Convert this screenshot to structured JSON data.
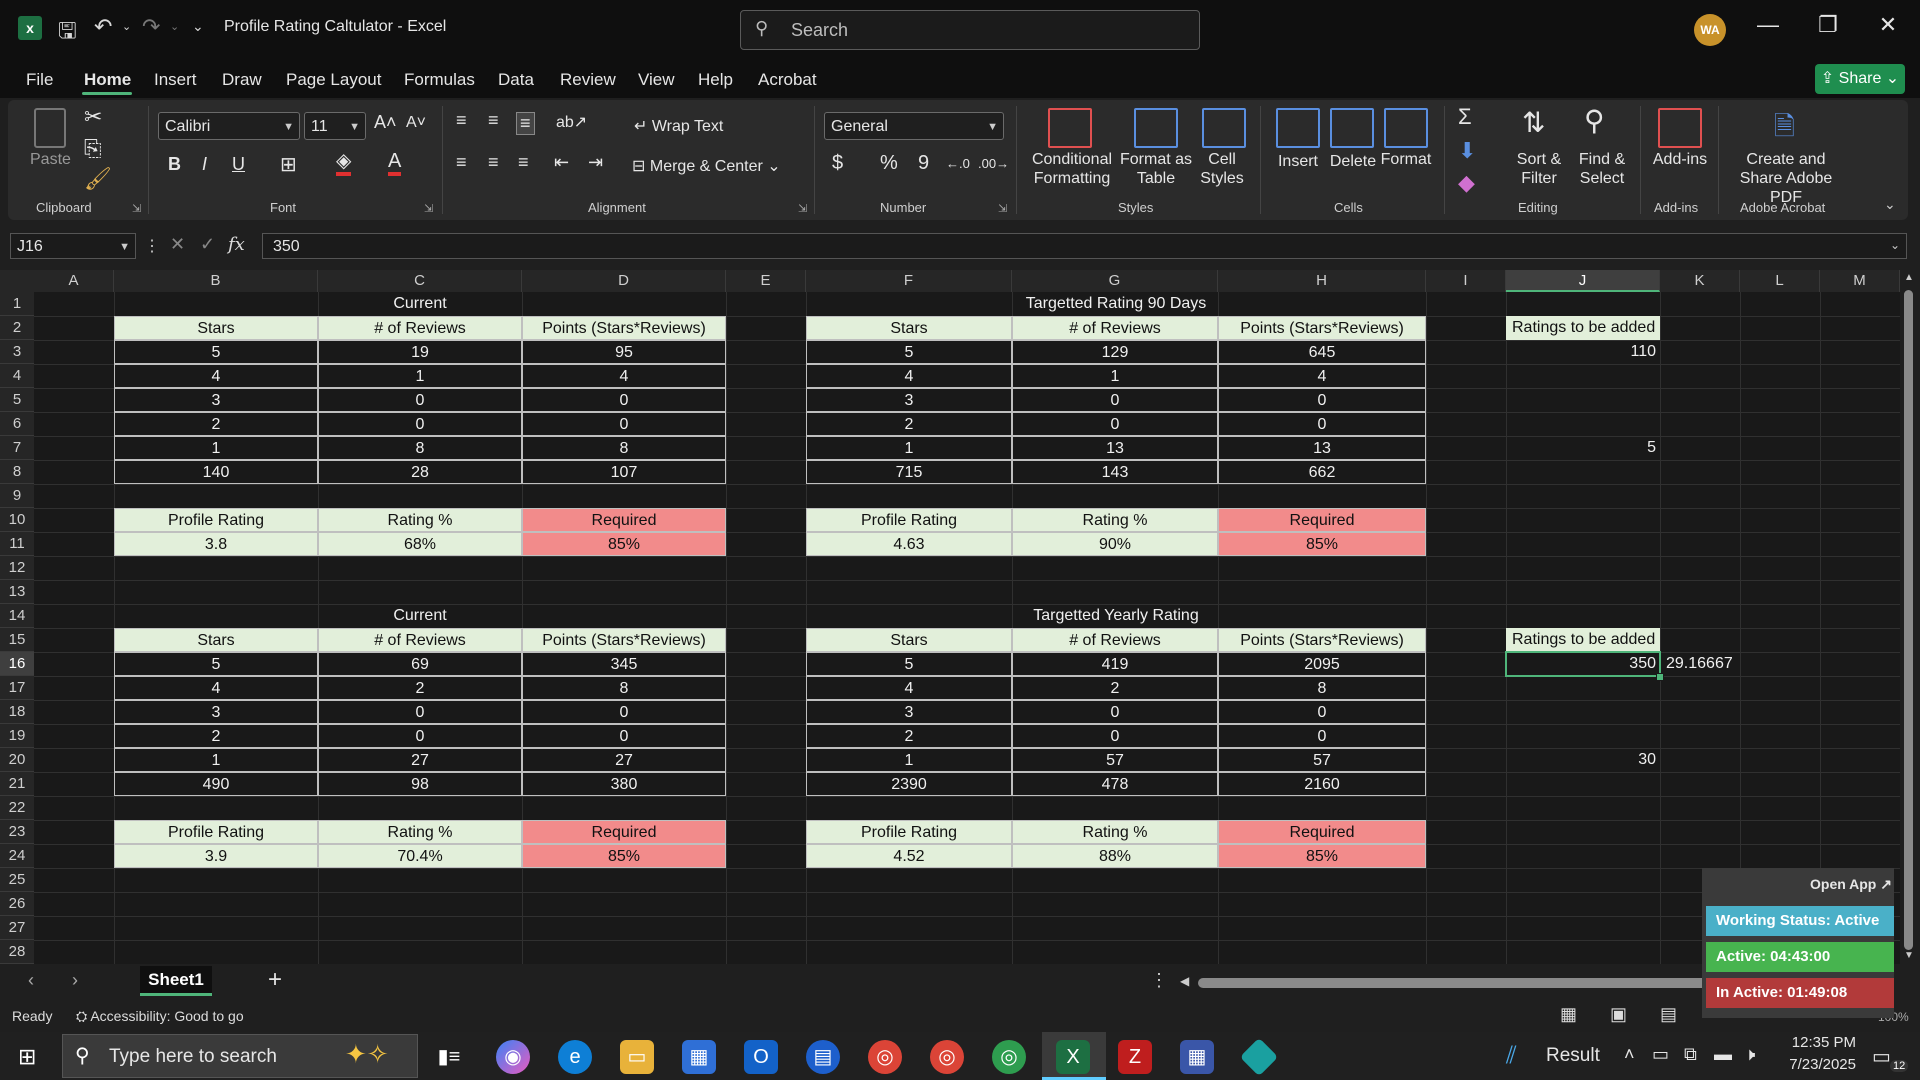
{
  "window": {
    "title": "Profile Rating Caltulator  -  Excel",
    "search_placeholder": "Search",
    "avatar_initials": "WA"
  },
  "menu": [
    "File",
    "Home",
    "Insert",
    "Draw",
    "Page Layout",
    "Formulas",
    "Data",
    "Review",
    "View",
    "Help",
    "Acrobat"
  ],
  "share_label": "Share",
  "ribbon": {
    "clipboard": {
      "paste": "Paste",
      "group": "Clipboard"
    },
    "font": {
      "name": "Calibri",
      "size": "11",
      "group": "Font",
      "bold": "B",
      "italic": "I",
      "underline": "U"
    },
    "alignment": {
      "wrap": "Wrap Text",
      "merge": "Merge & Center",
      "group": "Alignment"
    },
    "number": {
      "format": "General",
      "group": "Number",
      "currency": "$",
      "percent": "%",
      "comma": "9"
    },
    "styles": {
      "conditional": "Conditional Formatting",
      "format_table": "Format as Table",
      "cell_styles": "Cell Styles",
      "group": "Styles"
    },
    "cells": {
      "insert": "Insert",
      "delete": "Delete",
      "format": "Format",
      "group": "Cells"
    },
    "editing": {
      "sort": "Sort & Filter",
      "find": "Find & Select",
      "group": "Editing",
      "sigma": "Σ"
    },
    "addins": {
      "label": "Add-ins",
      "group": "Add-ins"
    },
    "acrobat": {
      "label": "Create and Share Adobe PDF",
      "group": "Adobe Acrobat"
    }
  },
  "formula_bar": {
    "name_box": "J16",
    "fx": "fx",
    "value": "350"
  },
  "columns": [
    "A",
    "B",
    "C",
    "D",
    "E",
    "F",
    "G",
    "H",
    "I",
    "J",
    "K",
    "L",
    "M"
  ],
  "rows": [
    "1",
    "2",
    "3",
    "4",
    "5",
    "6",
    "7",
    "8",
    "9",
    "10",
    "11",
    "12",
    "13",
    "14",
    "15",
    "16",
    "17",
    "18",
    "19",
    "20",
    "21",
    "22",
    "23",
    "24",
    "25",
    "26",
    "27",
    "28"
  ],
  "sheet": {
    "current_1": {
      "title": "Current",
      "headers": [
        "Stars",
        "# of Reviews",
        "Points (Stars*Reviews)"
      ],
      "rows": [
        [
          "5",
          "19",
          "95"
        ],
        [
          "4",
          "1",
          "4"
        ],
        [
          "3",
          "0",
          "0"
        ],
        [
          "2",
          "0",
          "0"
        ],
        [
          "1",
          "8",
          "8"
        ],
        [
          "140",
          "28",
          "107"
        ]
      ],
      "summary_headers": [
        "Profile Rating",
        "Rating %",
        "Required"
      ],
      "summary_values": [
        "3.8",
        "68%",
        "85%"
      ]
    },
    "target_90": {
      "title": "Targetted Rating 90 Days",
      "headers": [
        "Stars",
        "# of Reviews",
        "Points (Stars*Reviews)"
      ],
      "rows": [
        [
          "5",
          "129",
          "645"
        ],
        [
          "4",
          "1",
          "4"
        ],
        [
          "3",
          "0",
          "0"
        ],
        [
          "2",
          "0",
          "0"
        ],
        [
          "1",
          "13",
          "13"
        ],
        [
          "715",
          "143",
          "662"
        ]
      ],
      "summary_headers": [
        "Profile Rating",
        "Rating %",
        "Required"
      ],
      "summary_values": [
        "4.63",
        "90%",
        "85%"
      ]
    },
    "current_2": {
      "title": "Current",
      "headers": [
        "Stars",
        "# of Reviews",
        "Points (Stars*Reviews)"
      ],
      "rows": [
        [
          "5",
          "69",
          "345"
        ],
        [
          "4",
          "2",
          "8"
        ],
        [
          "3",
          "0",
          "0"
        ],
        [
          "2",
          "0",
          "0"
        ],
        [
          "1",
          "27",
          "27"
        ],
        [
          "490",
          "98",
          "380"
        ]
      ],
      "summary_headers": [
        "Profile Rating",
        "Rating %",
        "Required"
      ],
      "summary_values": [
        "3.9",
        "70.4%",
        "85%"
      ]
    },
    "target_yearly": {
      "title": "Targetted Yearly Rating",
      "headers": [
        "Stars",
        "# of Reviews",
        "Points (Stars*Reviews)"
      ],
      "rows": [
        [
          "5",
          "419",
          "2095"
        ],
        [
          "4",
          "2",
          "8"
        ],
        [
          "3",
          "0",
          "0"
        ],
        [
          "2",
          "0",
          "0"
        ],
        [
          "1",
          "57",
          "57"
        ],
        [
          "2390",
          "478",
          "2160"
        ]
      ],
      "summary_headers": [
        "Profile Rating",
        "Rating %",
        "Required"
      ],
      "summary_values": [
        "4.52",
        "88%",
        "85%"
      ]
    },
    "ratings_1": {
      "label": "Ratings to be added",
      "value_a": "110",
      "value_b": "5"
    },
    "ratings_2": {
      "label": "Ratings to be added",
      "value_a": "350",
      "value_k": "29.16667",
      "value_b": "30"
    }
  },
  "sheet_tab": "Sheet1",
  "status": {
    "ready": "Ready",
    "accessibility": "Accessibility: Good to go",
    "zoom": "100%"
  },
  "widget": {
    "open_app": "Open App ↗",
    "working": "Working Status: Active",
    "active": "Active: 04:43:00",
    "inactive": "In Active: 01:49:08"
  },
  "colors": {
    "green_fill": "#e2efda",
    "red_fill": "#f28b8b",
    "accent": "#4fb57a"
  },
  "taskbar": {
    "search_placeholder": "Type here to search",
    "weather": "Result",
    "time": "12:35 PM",
    "date": "7/23/2025",
    "notifications": "12"
  }
}
